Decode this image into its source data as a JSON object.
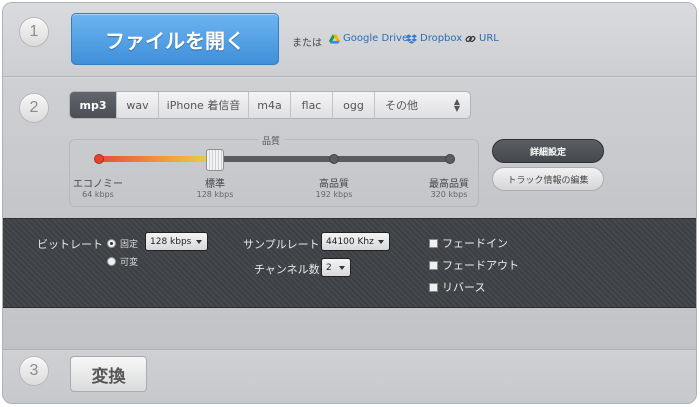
{
  "steps": {
    "one": "1",
    "two": "2",
    "three": "3"
  },
  "source": {
    "open_label": "ファイルを開く",
    "or_label": "または",
    "google_drive": "Google Drive",
    "dropbox": "Dropbox",
    "url": "URL",
    "icons": {
      "google_drive": "google-drive-icon",
      "dropbox": "dropbox-icon",
      "url": "link-icon"
    }
  },
  "formats": {
    "tabs": [
      "mp3",
      "wav",
      "iPhone 着信音",
      "m4a",
      "flac",
      "ogg",
      "その他"
    ],
    "selected": "mp3"
  },
  "quality": {
    "title": "品質",
    "selected_fraction": 0.333,
    "levels": [
      {
        "label": "エコノミー",
        "bitrate": "64 kbps"
      },
      {
        "label": "標準",
        "bitrate": "128 kbps"
      },
      {
        "label": "高品質",
        "bitrate": "192 kbps"
      },
      {
        "label": "最高品質",
        "bitrate": "320 kbps"
      }
    ]
  },
  "buttons": {
    "advanced": "詳細設定",
    "track_info": "トラック情報の編集",
    "convert": "変換"
  },
  "advanced": {
    "bitrate_label": "ビットレート",
    "fixed_label": "固定",
    "variable_label": "可変",
    "bitrate_value": "128 kbps",
    "sample_rate_label": "サンプルレート",
    "sample_rate_value": "44100 Khz",
    "channels_label": "チャンネル数",
    "channels_value": "2",
    "fade_in": "フェードイン",
    "fade_out": "フェードアウト",
    "reverse": "リバース"
  },
  "colors": {
    "accent_blue": "#4a9be3",
    "dark_band": "#3f4247",
    "link": "#2b6db3"
  }
}
